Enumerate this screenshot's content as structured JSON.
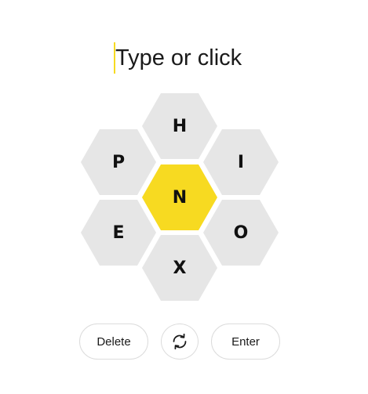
{
  "input": {
    "placeholder": "Type or click"
  },
  "hive": {
    "center_letter": "N",
    "outer_letters": {
      "top": "H",
      "upper_left": "P",
      "upper_right": "I",
      "lower_left": "E",
      "lower_right": "O",
      "bottom": "X"
    }
  },
  "controls": {
    "delete_label": "Delete",
    "shuffle_icon": "shuffle-icon",
    "enter_label": "Enter"
  },
  "colors": {
    "center_cell": "#f7da21",
    "outer_cell": "#e6e6e6",
    "caret": "#f7da21"
  }
}
